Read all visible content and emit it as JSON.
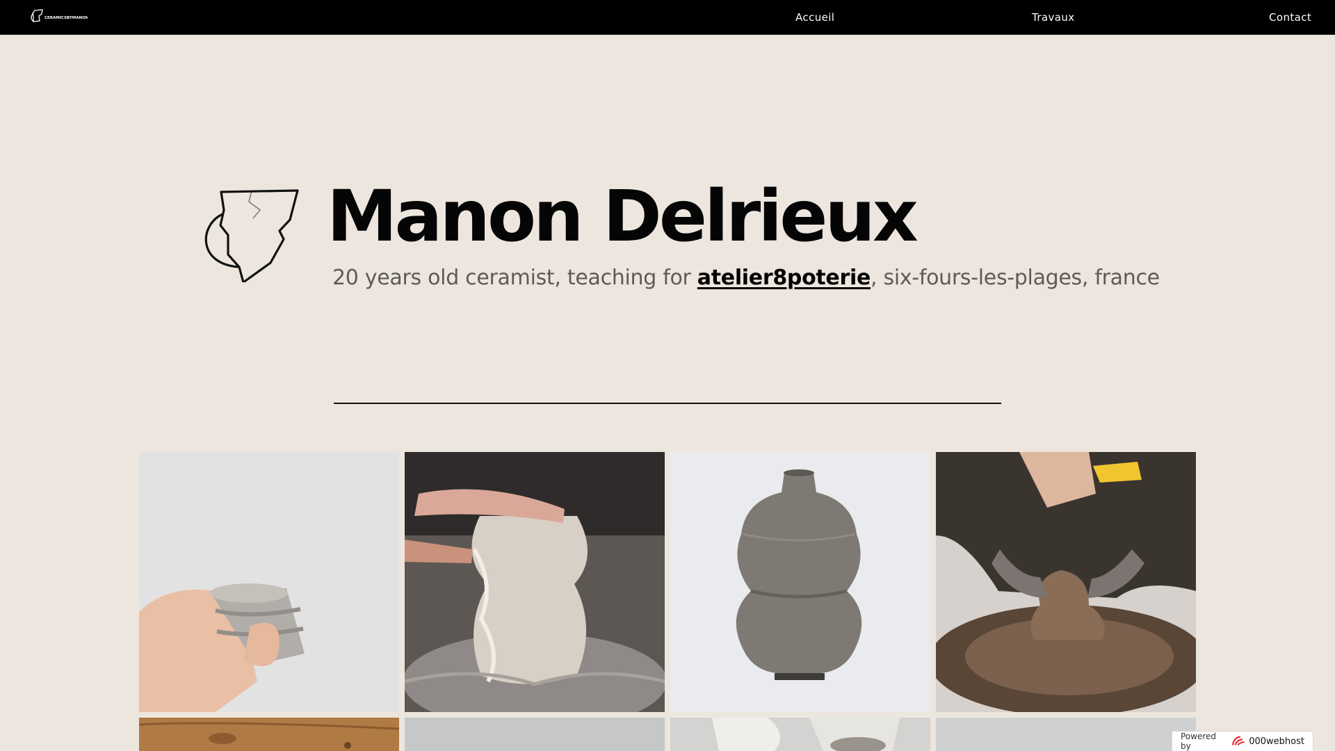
{
  "nav": {
    "logo_text": "CERAMICS BY MANON",
    "links": [
      {
        "label": "Accueil"
      },
      {
        "label": "Travaux"
      },
      {
        "label": "Contact"
      }
    ]
  },
  "hero": {
    "title": "Manon Delrieux",
    "subtitle_before": "20 years old ceramist, teaching for ",
    "subtitle_link": "atelier8poterie",
    "subtitle_after": ", six-fours-les-plages, france"
  },
  "gallery": {
    "items": [
      {
        "subject": "hand-holding-grey-stoneware-cup"
      },
      {
        "subject": "shaping-pot-on-wheel"
      },
      {
        "subject": "grey-speckled-bulbous-vase"
      },
      {
        "subject": "potter-throwing-at-wheel"
      },
      {
        "subject": "wooden-workbench"
      },
      {
        "subject": "grey-backdrop-photo"
      },
      {
        "subject": "hands-with-clay"
      },
      {
        "subject": "grey-backdrop-photo"
      }
    ]
  },
  "badge": {
    "label": "Powered by",
    "brand": "000webhost"
  },
  "colors": {
    "page_bg": "#ede6de",
    "nav_bg": "#000000",
    "title": "#050505",
    "subtitle": "#5d5a57"
  }
}
